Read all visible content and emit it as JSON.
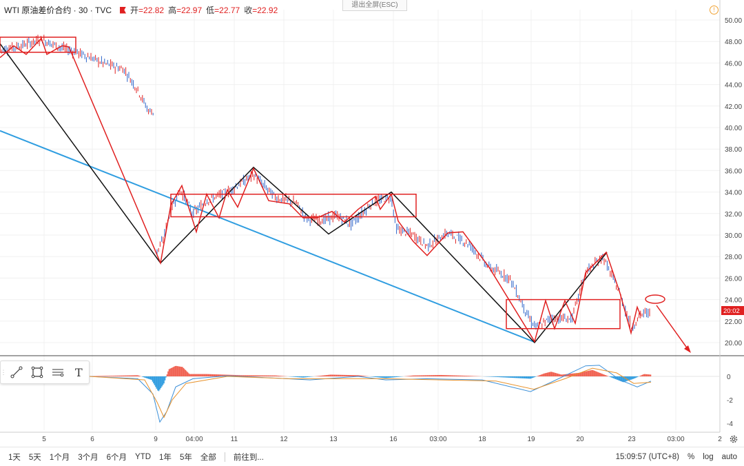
{
  "header": {
    "symbol": "WTI 原油差价合约 · 30 · TVC",
    "open_label": "开",
    "open": "=22.82",
    "high_label": "高",
    "high": "=22.97",
    "low_label": "低",
    "low": "=22.77",
    "close_label": "收",
    "close": "=22.92",
    "exit_fullscreen": "退出全屏(ESC)"
  },
  "price_axis": {
    "ticks": [
      "50.00",
      "48.00",
      "46.00",
      "44.00",
      "42.00",
      "40.00",
      "38.00",
      "36.00",
      "34.00",
      "32.00",
      "30.00",
      "28.00",
      "26.00",
      "24.00",
      "22.00",
      "20.00"
    ],
    "last_price_label": "20:02"
  },
  "indicator_axis": {
    "ticks": [
      "0",
      "-2",
      "-4"
    ]
  },
  "time_axis": {
    "ticks": [
      "5",
      "6",
      "9",
      "04:00",
      "11",
      "12",
      "13",
      "16",
      "03:00",
      "18",
      "19",
      "20",
      "23",
      "03:00",
      "2"
    ]
  },
  "bottom_bar": {
    "timeframes": [
      "1天",
      "5天",
      "1个月",
      "3个月",
      "6个月",
      "YTD",
      "1年",
      "5年",
      "全部"
    ],
    "goto_label": "前往到...",
    "clock": "15:09:57 (UTC+8)",
    "percent": "%",
    "log": "log",
    "auto": "auto"
  },
  "colors": {
    "up": "#e02020",
    "down": "#2a62c8",
    "trendline": "#2f9de0",
    "pattern": "#111111",
    "accent_red": "#e02020",
    "histogram_pos": "#f06050",
    "histogram_neg": "#2f9de0"
  },
  "chart_data": {
    "type": "line",
    "series": [
      {
        "x": [
          "5",
          "6",
          "9",
          "04:00",
          "11",
          "12",
          "13",
          "16",
          "03:00",
          "18",
          "19",
          "20",
          "23"
        ],
        "values": [
          48.0,
          46.5,
          28.2,
          33.0,
          35.5,
          32.8,
          31.2,
          33.2,
          29.0,
          27.5,
          21.2,
          27.5,
          22.9
        ]
      }
    ],
    "ylim": [
      18.5,
      51.0
    ],
    "indicator_ylim": [
      -4.5,
      0.8
    ]
  },
  "icons": [
    "trend-line-icon",
    "rectangle-icon",
    "horizontal-lines-icon",
    "text-icon",
    "gear-icon",
    "alert-icon"
  ]
}
